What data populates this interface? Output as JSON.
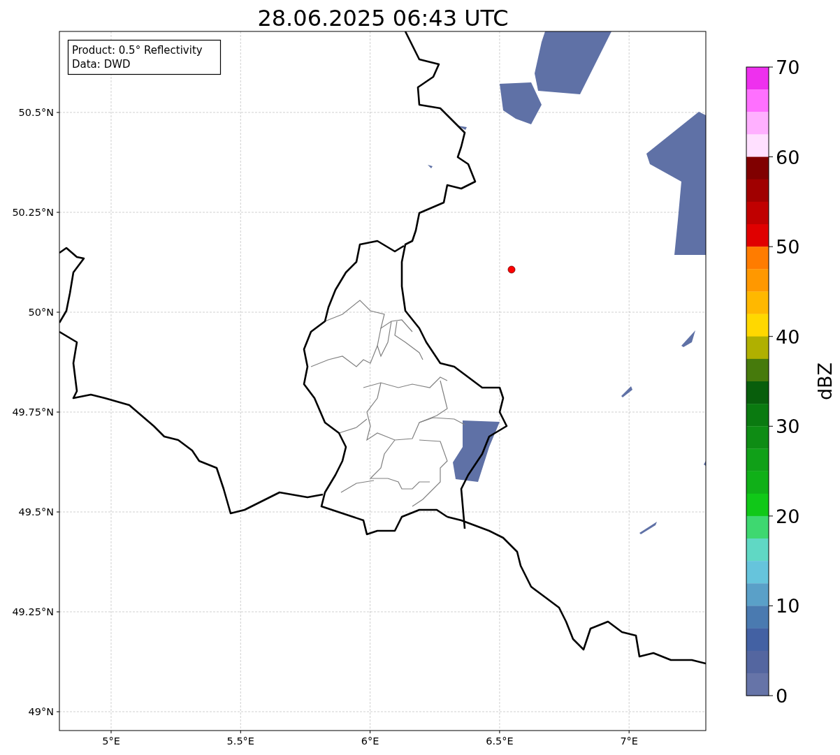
{
  "title": "28.06.2025 06:43 UTC",
  "map": {
    "info_box": [
      "Product: 0.5° Reflectivity",
      "Data: DWD"
    ],
    "y_ticks": [
      "50.5°N",
      "50.25°N",
      "50°N",
      "49.75°N",
      "49.5°N",
      "49.25°N",
      "49°N"
    ],
    "x_ticks": [
      "5°E",
      "5.5°E",
      "6°E",
      "6.5°E",
      "7°E"
    ]
  },
  "colorbar": {
    "label": "dBZ",
    "ticks": [
      "70",
      "60",
      "50",
      "40",
      "30",
      "20",
      "10",
      "0"
    ],
    "bins": [
      {
        "color": "#ee30ee"
      },
      {
        "color": "#ff70ff"
      },
      {
        "color": "#ffb0ff"
      },
      {
        "color": "#ffe0ff"
      },
      {
        "color": "#800000"
      },
      {
        "color": "#a00000"
      },
      {
        "color": "#c00000"
      },
      {
        "color": "#e00000"
      },
      {
        "color": "#ff7c00"
      },
      {
        "color": "#ff9800"
      },
      {
        "color": "#ffb800"
      },
      {
        "color": "#ffd800"
      },
      {
        "color": "#b0b000"
      },
      {
        "color": "#467a0c"
      },
      {
        "color": "#085e0c"
      },
      {
        "color": "#0a7a10"
      },
      {
        "color": "#0e8c14"
      },
      {
        "color": "#10a018"
      },
      {
        "color": "#10b018"
      },
      {
        "color": "#10c818"
      },
      {
        "color": "#3ed870"
      },
      {
        "color": "#60d8c4"
      },
      {
        "color": "#66c4dc"
      },
      {
        "color": "#5aa0c8"
      },
      {
        "color": "#4a7ab0"
      },
      {
        "color": "#4361a3"
      },
      {
        "color": "#5466a0"
      },
      {
        "color": "#6674a8"
      }
    ]
  }
}
